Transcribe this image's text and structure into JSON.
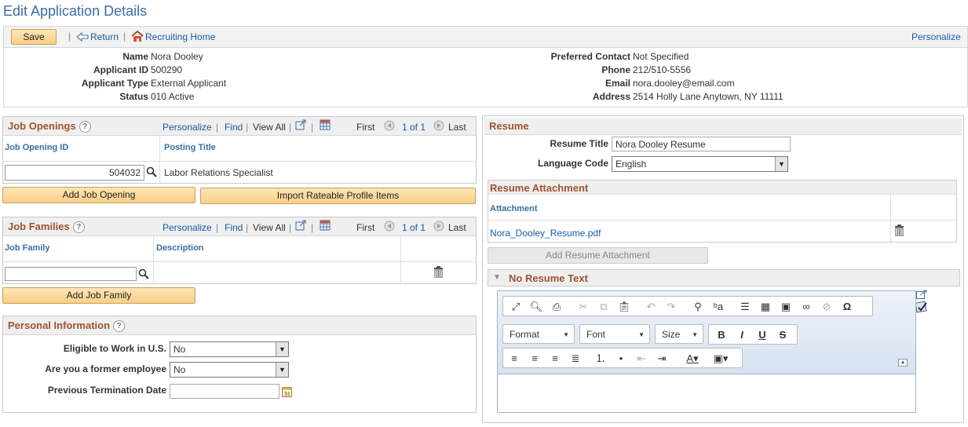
{
  "page_title": "Edit Application Details",
  "toolbar": {
    "save": "Save",
    "return": "Return",
    "recruiting_home": "Recruiting Home",
    "personalize": "Personalize"
  },
  "applicant": {
    "name_label": "Name",
    "name": "Nora Dooley",
    "id_label": "Applicant ID",
    "id": "500290",
    "type_label": "Applicant Type",
    "type": "External Applicant",
    "status_label": "Status",
    "status": "010 Active",
    "contact_label": "Preferred Contact",
    "contact": "Not Specified",
    "phone_label": "Phone",
    "phone": "212/510-5556",
    "email_label": "Email",
    "email": "nora.dooley@email.com",
    "address_label": "Address",
    "address": "2514 Holly Lane Anytown, NY 11111"
  },
  "nav": {
    "personalize": "Personalize",
    "find": "Find",
    "view_all": "View All",
    "first": "First",
    "count": "1 of 1",
    "last": "Last"
  },
  "job_openings": {
    "title": "Job Openings",
    "col_id": "Job Opening ID",
    "col_title": "Posting Title",
    "row_id": "504032",
    "row_title": "Labor Relations Specialist",
    "add_btn": "Add Job Opening",
    "import_btn": "Import Rateable Profile Items"
  },
  "job_families": {
    "title": "Job Families",
    "col_family": "Job Family",
    "col_desc": "Description",
    "add_btn": "Add Job Family"
  },
  "personal": {
    "title": "Personal Information",
    "eligible_label": "Eligible to Work in U.S.",
    "eligible": "No",
    "former_label": "Are you a former employee",
    "former": "No",
    "term_label": "Previous Termination Date"
  },
  "resume": {
    "title": "Resume",
    "resume_title_label": "Resume Title",
    "resume_title": "Nora Dooley Resume",
    "language_label": "Language Code",
    "language": "English",
    "attach_section": "Resume Attachment",
    "attach_col": "Attachment",
    "attach_file": "Nora_Dooley_Resume.pdf",
    "add_attach_btn": "Add Resume Attachment",
    "no_text": "No Resume Text"
  },
  "editor": {
    "format": "Format",
    "font": "Font",
    "size": "Size",
    "bold": "B",
    "italic": "I",
    "underline": "U",
    "strike": "S",
    "omega": "Ω"
  }
}
